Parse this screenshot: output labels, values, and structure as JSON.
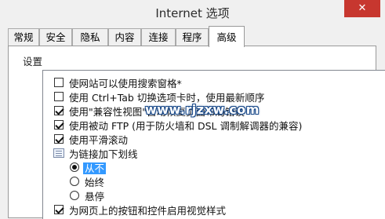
{
  "window": {
    "title": "Internet 选项",
    "close_symbol": "✕"
  },
  "tabs": [
    {
      "label": "常规"
    },
    {
      "label": "安全"
    },
    {
      "label": "隐私"
    },
    {
      "label": "内容"
    },
    {
      "label": "连接"
    },
    {
      "label": "程序"
    },
    {
      "label": "高级",
      "active": true
    }
  ],
  "settings": {
    "label": "设置",
    "items": [
      {
        "kind": "checkbox",
        "checked": false,
        "label": "使网站可以使用搜索窗格*"
      },
      {
        "kind": "checkbox",
        "checked": false,
        "label": "使用 Ctrl+Tab 切换选项卡时，使用最新顺序"
      },
      {
        "kind": "checkbox",
        "checked": true,
        "label": "使用\"兼容性视图\"自动恢复页面布局错误"
      },
      {
        "kind": "checkbox",
        "checked": true,
        "label": "使用被动 FTP (用于防火墙和 DSL 调制解调器的兼容)"
      },
      {
        "kind": "checkbox",
        "checked": true,
        "label": "使用平滑滚动"
      },
      {
        "kind": "group",
        "label": "为链接加下划线"
      },
      {
        "kind": "radio",
        "checked": true,
        "selected": true,
        "label": "从不"
      },
      {
        "kind": "radio",
        "checked": false,
        "label": "始终"
      },
      {
        "kind": "radio",
        "checked": false,
        "label": "悬停"
      },
      {
        "kind": "checkbox",
        "checked": true,
        "label": "为网页上的按钮和控件启用视觉样式"
      }
    ]
  },
  "watermark": {
    "text": "www.rjzxw.com"
  }
}
